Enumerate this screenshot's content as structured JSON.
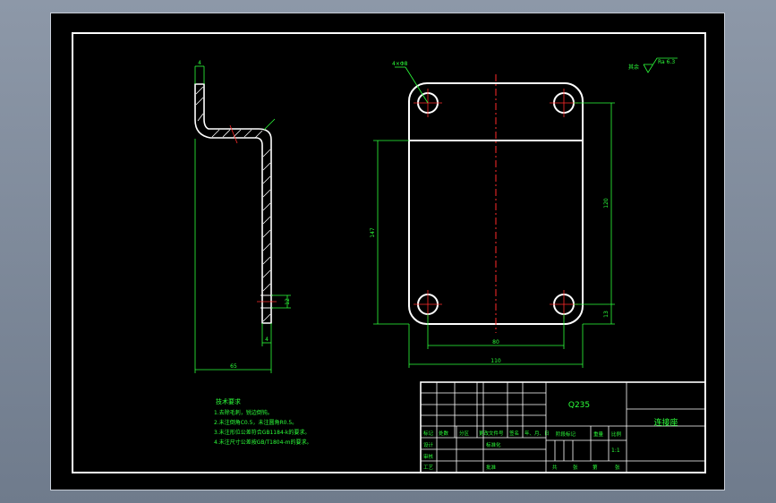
{
  "part_name": "连接座",
  "material": "Q235",
  "scale": "1:1",
  "roughness": {
    "prefix": "其余",
    "value": "Ra 6.3"
  },
  "side_view_dims": {
    "thickness": "4",
    "width": "65",
    "hole": "12",
    "bottom": "4"
  },
  "front_view_dims": {
    "hole_label": "4×Φ8",
    "overall_width": "110",
    "hole_spacing_x": "80",
    "overall_height": "147",
    "hole_spacing_y": "120",
    "edge_offset": "13"
  },
  "tech_requirements": {
    "title": "技术要求",
    "items": [
      "1.去除毛刺，锐边倒钝。",
      "2.未注倒角C0.5，未注圆角R0.5。",
      "3.未注形位公差符合GB1184-k的要求。",
      "4.未注尺寸公差按GB/T1804-m的要求。"
    ]
  },
  "title_block": {
    "header": [
      "标记",
      "处数",
      "分区",
      "更改文件号",
      "签名",
      "年、月、日"
    ],
    "design": "设计",
    "standard": "标准化",
    "review": "审核",
    "process": "工艺",
    "approve": "批准",
    "stage_mark": "阶段标记",
    "weight": "重量",
    "ratio": "比例",
    "sheets": [
      "共",
      "张",
      "第",
      "张"
    ]
  }
}
